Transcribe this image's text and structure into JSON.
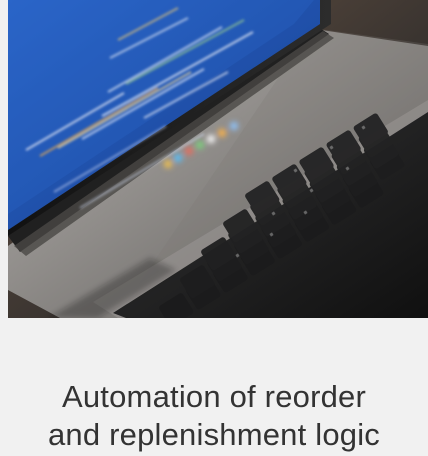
{
  "card": {
    "title_line1": "Automation of reorder",
    "title_line2": "and replenishment logic"
  },
  "image": {
    "subject": "laptop-with-code-on-screen"
  },
  "colors": {
    "background": "#f1f1f1",
    "title_text": "#333333",
    "screen_blue": "#1f4fa8",
    "laptop_body": "#9c9a98",
    "keys": "#202124"
  }
}
